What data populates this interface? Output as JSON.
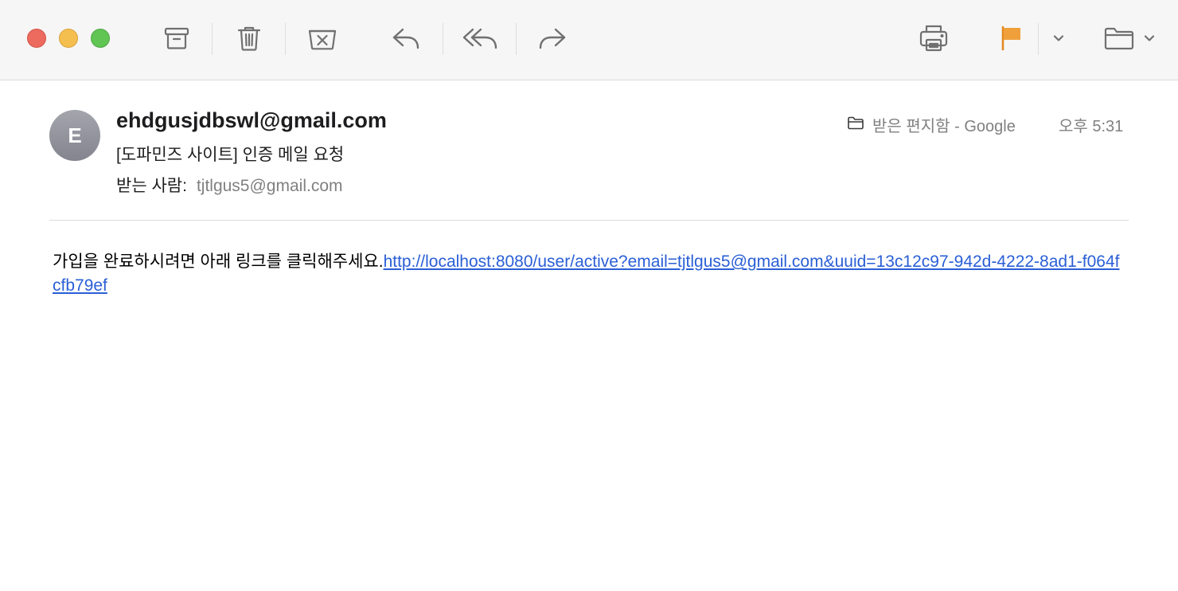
{
  "window": {
    "colors": {
      "close": "#ed6a5e",
      "minimize": "#f5bf4f",
      "zoom": "#61c554"
    }
  },
  "toolbar": {
    "icons": [
      "archive-icon",
      "trash-icon",
      "junk-icon",
      "reply-icon",
      "reply-all-icon",
      "forward-icon",
      "print-icon",
      "flag-icon",
      "chevron-down-icon",
      "folder-icon",
      "chevron-down-icon"
    ],
    "flag_color": "#f0a03a"
  },
  "message": {
    "avatar_initial": "E",
    "sender": "ehdgusjdbswl@gmail.com",
    "subject": "[도파민즈 사이트] 인증 메일 요청",
    "to_label": "받는 사람:",
    "to_address": "tjtlgus5@gmail.com",
    "mailbox": "받은 편지함 - Google",
    "time": "오후 5:31",
    "body_text": "가입을 완료하시려면 아래 링크를 클릭해주세요.",
    "body_link": "http://localhost:8080/user/active?email=tjtlgus5@gmail.com&uuid=13c12c97-942d-4222-8ad1-f064fcfb79ef",
    "link_color": "#2a5fd6"
  }
}
